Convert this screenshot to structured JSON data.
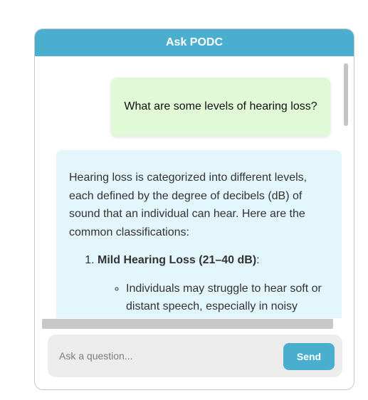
{
  "header": {
    "title": "Ask PODC"
  },
  "messages": {
    "user_question": "What are some levels of hearing loss?",
    "bot_intro": "Hearing loss is categorized into different levels, each defined by the degree of decibels (dB) of sound that an individual can hear. Here are the common classifications:",
    "list": [
      {
        "number": "1.",
        "title": "Mild Hearing Loss (21–40 dB)",
        "suffix": ":",
        "bullets": [
          "Individuals may struggle to hear soft or distant speech, especially in noisy"
        ]
      }
    ]
  },
  "input": {
    "placeholder": "Ask a question...",
    "value": ""
  },
  "send_button": {
    "label": "Send"
  },
  "colors": {
    "accent": "#4aafce",
    "user_bubble": "#e0fad8",
    "bot_bubble": "#e3f6fb",
    "input_bg": "#ececec"
  }
}
